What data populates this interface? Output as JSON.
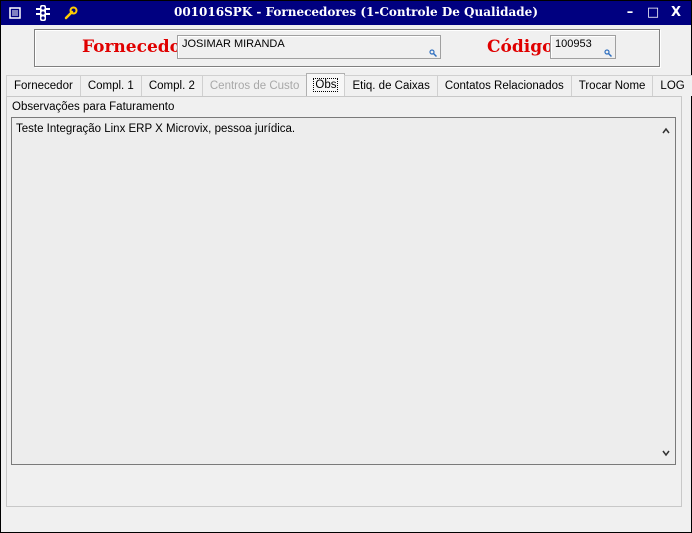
{
  "titlebar": {
    "title": "001016SPK - Fornecedores (1-Controle De Qualidade)",
    "icons": [
      "menu-icon",
      "traffic-light-icon",
      "wrench-icon"
    ],
    "minimize": "–",
    "maximize": "□",
    "close": "X"
  },
  "header": {
    "supplier_label": "Fornecedor",
    "supplier_value": "JOSIMAR MIRANDA",
    "code_label": "Código",
    "code_value": "100953"
  },
  "tabs": [
    {
      "label": "Fornecedor",
      "state": "normal"
    },
    {
      "label": "Compl. 1",
      "state": "normal"
    },
    {
      "label": "Compl. 2",
      "state": "normal"
    },
    {
      "label": "Centros de Custo",
      "state": "disabled"
    },
    {
      "label": "Obs",
      "state": "active"
    },
    {
      "label": "Etiq. de Caixas",
      "state": "normal"
    },
    {
      "label": "Contatos Relacionados",
      "state": "normal"
    },
    {
      "label": "Trocar Nome",
      "state": "normal"
    },
    {
      "label": "LOG",
      "state": "normal"
    }
  ],
  "obs": {
    "label": "Observações para Faturamento",
    "text": "Teste Integração Linx ERP X Microvix, pessoa jurídica."
  },
  "colors": {
    "titlebar_bg": "#000080",
    "label_red": "#e00000",
    "window_bg": "#f0f0f0"
  }
}
